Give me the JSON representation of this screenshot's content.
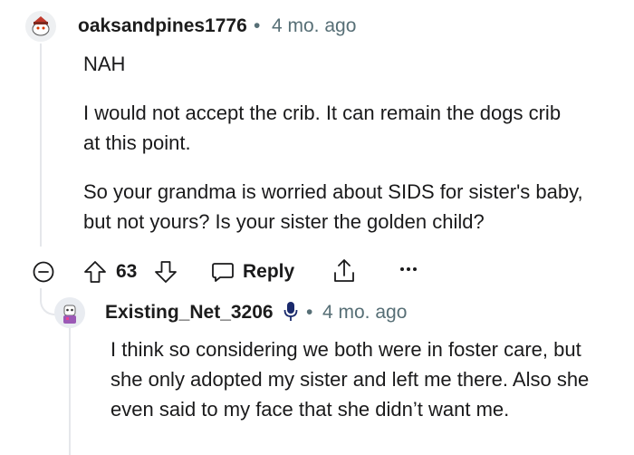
{
  "comment": {
    "username": "oaksandpines1776",
    "separator": "•",
    "time": "4 mo. ago",
    "paragraphs": [
      "NAH",
      "I would not accept the crib. It can remain the dogs crib at this point.",
      "So your grandma is worried about SIDS for sister's baby, but not yours? Is your sister the golden child?"
    ],
    "votes": "63",
    "reply_label": "Reply"
  },
  "reply": {
    "username": "Existing_Net_3206",
    "separator": "•",
    "time": "4 mo. ago",
    "text": "I think so considering we both were in foster care, but she only adopted my sister and left me there. Also she even said to my face that she didn’t want me."
  },
  "icons": {
    "collapse": "minus-circle-icon",
    "upvote": "arrow-up-icon",
    "downvote": "arrow-down-icon",
    "reply": "speech-bubble-icon",
    "share": "share-icon",
    "more": "more-dots-icon",
    "op_badge": "microphone-icon"
  },
  "colors": {
    "meta": "#576f76",
    "thread_line": "#e5e7eb",
    "badge": "#1a2a6c"
  }
}
